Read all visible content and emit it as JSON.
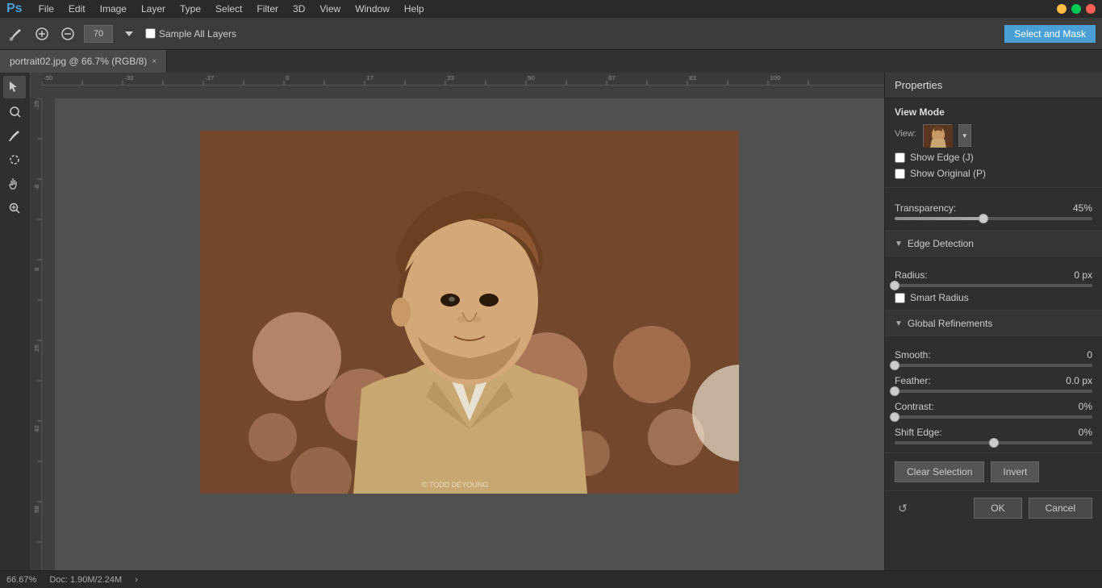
{
  "app": {
    "logo": "Ps",
    "title": "Adobe Photoshop"
  },
  "menu": {
    "items": [
      "File",
      "Edit",
      "Image",
      "Layer",
      "Type",
      "Select",
      "Filter",
      "3D",
      "View",
      "Window",
      "Help"
    ]
  },
  "toolbar": {
    "brush_size": "70",
    "sample_all_layers": "Sample All Layers",
    "select_mask": "Select and Mask"
  },
  "tab": {
    "filename": "portrait02.jpg @ 66.7% (RGB/8)",
    "close": "×"
  },
  "canvas": {
    "zoom": "66.67%",
    "doc_size": "Doc: 1.90M/2.24M"
  },
  "properties": {
    "title": "Properties",
    "view_mode": {
      "label": "View Mode",
      "view_label": "View:",
      "show_edge": "Show Edge (J)",
      "show_original": "Show Original (P)"
    },
    "transparency": {
      "label": "Transparency:",
      "value": "45%",
      "percent": 45
    },
    "edge_detection": {
      "label": "Edge Detection",
      "radius_label": "Radius:",
      "radius_value": "0 px",
      "smart_radius": "Smart Radius"
    },
    "global_refinements": {
      "label": "Global Refinements",
      "smooth_label": "Smooth:",
      "smooth_value": "0",
      "feather_label": "Feather:",
      "feather_value": "0.0 px",
      "contrast_label": "Contrast:",
      "contrast_value": "0%",
      "shift_edge_label": "Shift Edge:",
      "shift_edge_value": "0%"
    },
    "buttons": {
      "clear_selection": "Clear Selection",
      "invert": "Invert",
      "ok": "OK",
      "cancel": "Cancel"
    }
  }
}
